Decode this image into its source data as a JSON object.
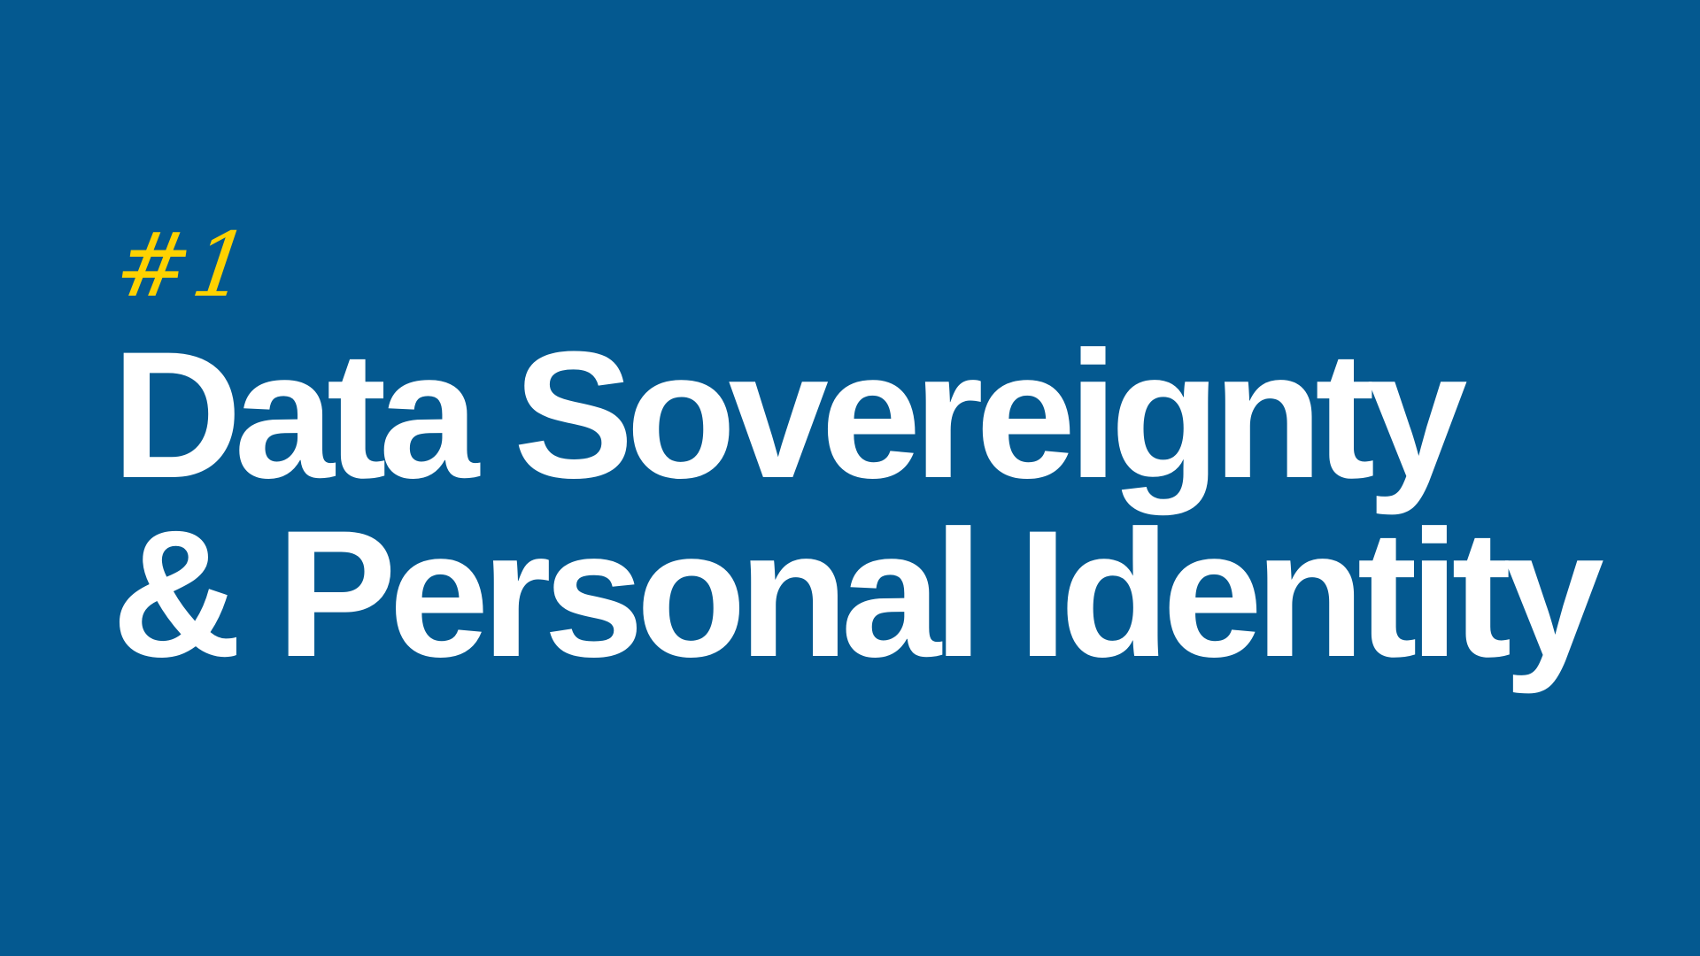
{
  "slide": {
    "number": "#1",
    "title_line1": "Data Sovereignty",
    "title_line2": "& Personal Identity",
    "colors": {
      "background": "#045990",
      "number": "#ffd200",
      "title": "#ffffff"
    }
  }
}
